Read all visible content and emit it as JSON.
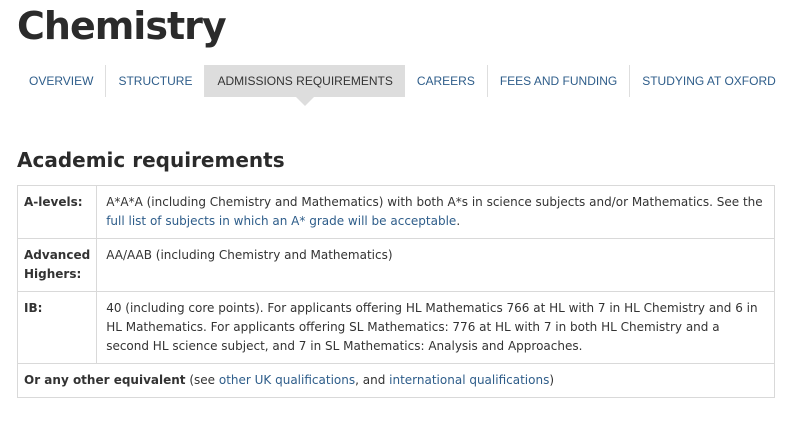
{
  "page": {
    "title": "Chemistry"
  },
  "tabs": [
    {
      "label": "OVERVIEW",
      "active": false
    },
    {
      "label": "STRUCTURE",
      "active": false
    },
    {
      "label": "ADMISSIONS REQUIREMENTS",
      "active": true
    },
    {
      "label": "CAREERS",
      "active": false
    },
    {
      "label": "FEES AND FUNDING",
      "active": false
    },
    {
      "label": "STUDYING AT OXFORD",
      "active": false
    }
  ],
  "section": {
    "title": "Academic requirements"
  },
  "requirements": {
    "alevels": {
      "label": "A-levels:",
      "text": "A*A*A (including Chemistry and Mathematics) with both A*s in science subjects and/or Mathematics. See the ",
      "link": "full list of subjects in which an A* grade will be acceptable",
      "suffix": "."
    },
    "advanced_highers": {
      "label": "Advanced Highers:",
      "text": "AA/AAB (including Chemistry and Mathematics)"
    },
    "ib": {
      "label": "IB:",
      "text": "40 (including core points). For applicants offering HL Mathematics 766 at HL with 7 in HL Chemistry and 6 in HL Mathematics. For applicants offering SL Mathematics: 776 at HL with 7 in both HL Chemistry and a second HL science subject, and 7 in SL Mathematics: Analysis and Approaches."
    },
    "other": {
      "bold": "Or any other equivalent",
      "prefix": " (see ",
      "link1": "other UK qualifications",
      "middle": ", and ",
      "link2": "international qualifications",
      "suffix": ")"
    }
  },
  "colors": {
    "link": "#2e5d8a",
    "active_tab_bg": "#dddddd",
    "border": "#d9d9d9"
  }
}
